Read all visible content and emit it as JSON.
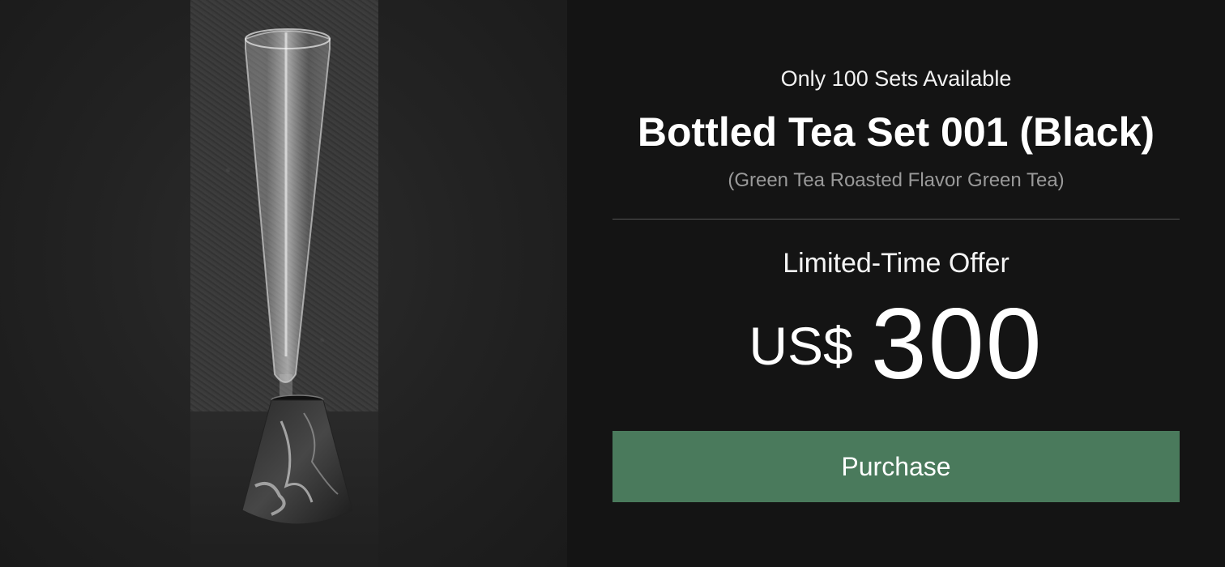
{
  "product_image": {
    "icon": "tall-glass-tea-bottle-image"
  },
  "product": {
    "availability": "Only 100 Sets Available",
    "title": "Bottled Tea Set 001 (Black)",
    "subtitle": "(Green Tea Roasted Flavor Green Tea)"
  },
  "pricing": {
    "offer_label": "Limited-Time Offer",
    "currency": "US$",
    "amount": "300"
  },
  "actions": {
    "purchase_label": "Purchase"
  },
  "colors": {
    "background": "#141414",
    "button": "#4a7a5c",
    "subtitle": "#9a9a9a"
  }
}
